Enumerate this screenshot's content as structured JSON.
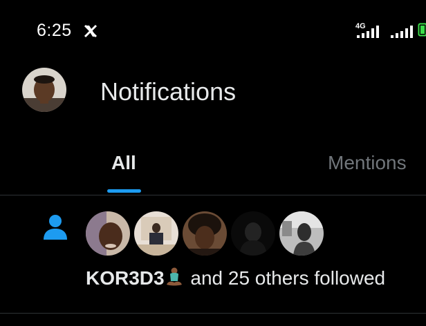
{
  "status_bar": {
    "time": "6:25",
    "network_type": "4G",
    "icons": [
      "x-logo-icon",
      "signal-icon",
      "signal-icon",
      "battery-icon"
    ]
  },
  "header": {
    "title": "Notifications",
    "avatar": "profile-avatar"
  },
  "tabs": [
    {
      "label": "All",
      "selected": true
    },
    {
      "label": "Mentions",
      "selected": false
    }
  ],
  "notification": {
    "icon": "person-icon",
    "avatars": [
      "follower-avatar",
      "follower-avatar",
      "follower-avatar",
      "follower-avatar",
      "follower-avatar"
    ],
    "name": "KOR3D3",
    "emoji": "person-in-lotus-position",
    "text": " and 25 others followed"
  },
  "colors": {
    "background": "#000000",
    "accent": "#1d9bf0",
    "text_primary": "#e7e9ea",
    "text_secondary": "#71767b",
    "divider": "#2f3336"
  }
}
